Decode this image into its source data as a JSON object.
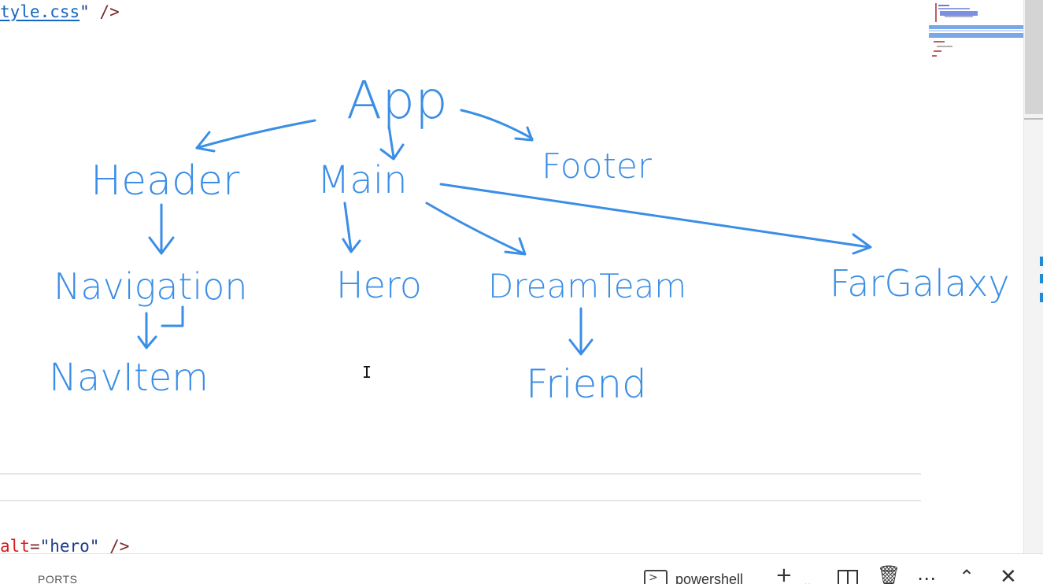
{
  "editor": {
    "code_top": {
      "link_text": "tyle.css",
      "quote": "\"",
      "close": " />"
    },
    "code_bottom": {
      "attr": "alt",
      "eq": "=",
      "value": "\"hero\"",
      "close": " />"
    }
  },
  "diagram": {
    "nodes": {
      "app": "App",
      "header": "Header",
      "main": "Main",
      "footer": "Footer",
      "navigation": "Navigation",
      "hero": "Hero",
      "dream_team": "DreamTeam",
      "far_galaxy": "FarGalaxy",
      "nav_item": "NavItem",
      "friend": "Friend"
    },
    "ink_color": "#3a8ee6"
  },
  "panel": {
    "tab_ports": "PORTS",
    "terminal_name": "powershell",
    "add_icon": "plus-icon",
    "dropdown_icon": "chevron-down-icon",
    "split_icon": "split-terminal-icon",
    "kill_icon": "trash-icon",
    "more_icon": "ellipsis-icon",
    "maximize_icon": "chevron-up-icon",
    "close_icon": "close-icon"
  }
}
